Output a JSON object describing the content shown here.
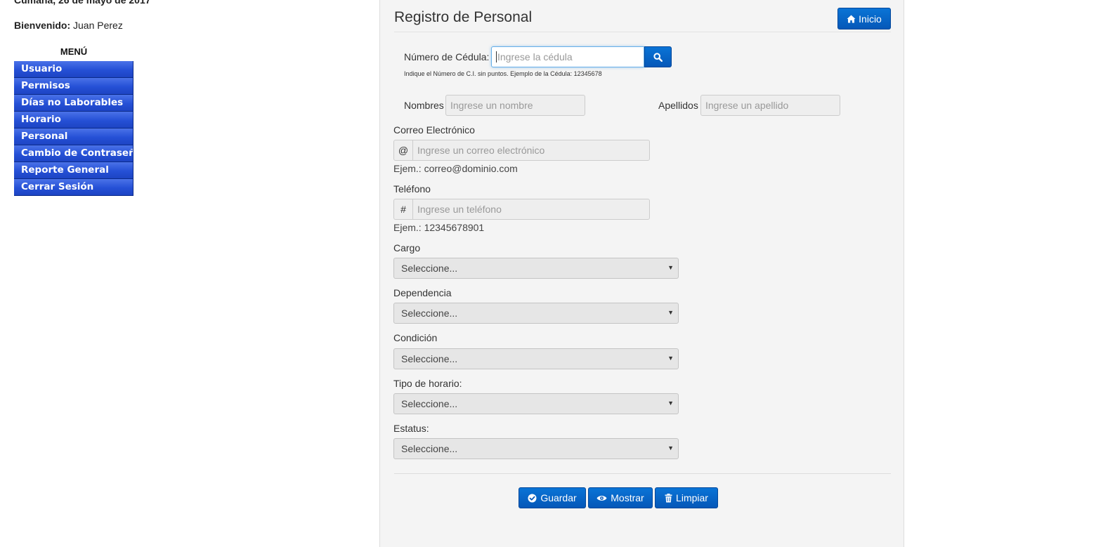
{
  "sidebar": {
    "date": "Cumaná, 26 de mayo de 2017",
    "welcome_label": "Bienvenido:",
    "user_name": "Juan Perez",
    "menu_title": "MENÚ",
    "menu_items": [
      {
        "label": "Usuario"
      },
      {
        "label": "Permisos"
      },
      {
        "label": "Días no Laborables"
      },
      {
        "label": "Horario"
      },
      {
        "label": "Personal"
      },
      {
        "label": "Cambio de Contraseña"
      },
      {
        "label": "Reporte General"
      },
      {
        "label": "Cerrar Sesión"
      }
    ],
    "menu_color": "#2a55d9"
  },
  "form": {
    "title": "Registro de Personal",
    "home_button": {
      "label": "Inicio",
      "icon": "home-icon"
    },
    "cedula": {
      "label": "Número de Cédula:",
      "placeholder": "Ingrese la cédula",
      "hint": "Indique el Número de C.I. sin puntos. Ejemplo de la Cédula: 12345678",
      "search_icon": "search-icon"
    },
    "nombres": {
      "label": "Nombres",
      "placeholder": "Ingrese un nombre"
    },
    "apellidos": {
      "label": "Apellidos",
      "placeholder": "Ingrese un apellido"
    },
    "correo": {
      "label": "Correo Electrónico",
      "addon": "@",
      "placeholder": "Ingrese un correo electrónico",
      "help": "Ejem.: correo@dominio.com"
    },
    "telefono": {
      "label": "Teléfono",
      "addon": "#",
      "placeholder": "Ingrese un teléfono",
      "help": "Ejem.: 12345678901"
    },
    "cargo": {
      "label": "Cargo",
      "value": "Seleccione..."
    },
    "dependencia": {
      "label": "Dependencia",
      "value": "Seleccione..."
    },
    "condicion": {
      "label": "Condición",
      "value": "Seleccione..."
    },
    "tipo_horario": {
      "label": "Tipo de horario:",
      "value": "Seleccione..."
    },
    "estatus": {
      "label": "Estatus:",
      "value": "Seleccione..."
    },
    "actions": {
      "guardar": {
        "label": "Guardar",
        "icon": "check-circle-icon"
      },
      "mostrar": {
        "label": "Mostrar",
        "icon": "eye-icon"
      },
      "limpiar": {
        "label": "Limpiar",
        "icon": "trash-icon"
      }
    },
    "accent_color": "#0a67cc"
  }
}
